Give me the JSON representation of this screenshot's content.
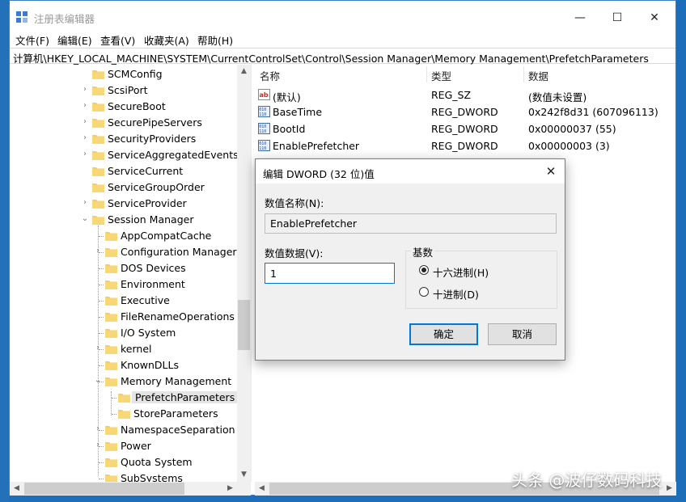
{
  "window": {
    "title": "注册表编辑器",
    "controls": {
      "minimize": "—",
      "maximize": "☐",
      "close": "✕"
    }
  },
  "menu": [
    "文件(F)",
    "编辑(E)",
    "查看(V)",
    "收藏夹(A)",
    "帮助(H)"
  ],
  "address": "计算机\\HKEY_LOCAL_MACHINE\\SYSTEM\\CurrentControlSet\\Control\\Session Manager\\Memory Management\\PrefetchParameters",
  "tree": [
    {
      "label": "SCMConfig",
      "expander": ""
    },
    {
      "label": "ScsiPort",
      "expander": "›"
    },
    {
      "label": "SecureBoot",
      "expander": "›"
    },
    {
      "label": "SecurePipeServers",
      "expander": "›"
    },
    {
      "label": "SecurityProviders",
      "expander": "›"
    },
    {
      "label": "ServiceAggregatedEvents",
      "expander": "›"
    },
    {
      "label": "ServiceCurrent",
      "expander": ""
    },
    {
      "label": "ServiceGroupOrder",
      "expander": ""
    },
    {
      "label": "ServiceProvider",
      "expander": "›"
    },
    {
      "label": "Session Manager",
      "expander": "⌄"
    },
    {
      "label": "AppCompatCache",
      "expander": ""
    },
    {
      "label": "Configuration Manager",
      "expander": "›"
    },
    {
      "label": "DOS Devices",
      "expander": ""
    },
    {
      "label": "Environment",
      "expander": ""
    },
    {
      "label": "Executive",
      "expander": ""
    },
    {
      "label": "FileRenameOperations",
      "expander": ""
    },
    {
      "label": "I/O System",
      "expander": ""
    },
    {
      "label": "kernel",
      "expander": "›"
    },
    {
      "label": "KnownDLLs",
      "expander": ""
    },
    {
      "label": "Memory Management",
      "expander": "⌄"
    },
    {
      "label": "PrefetchParameters",
      "expander": ""
    },
    {
      "label": "StoreParameters",
      "expander": ""
    },
    {
      "label": "NamespaceSeparation",
      "expander": "›"
    },
    {
      "label": "Power",
      "expander": "›"
    },
    {
      "label": "Quota System",
      "expander": ""
    },
    {
      "label": "SubSystems",
      "expander": ""
    }
  ],
  "list": {
    "headers": {
      "name": "名称",
      "type": "类型",
      "data": "数据"
    },
    "rows": [
      {
        "icon": "string-value-icon",
        "name": "(默认)",
        "type": "REG_SZ",
        "data": "(数值未设置)"
      },
      {
        "icon": "binary-value-icon",
        "name": "BaseTime",
        "type": "REG_DWORD",
        "data": "0x242f8d31 (607096113)"
      },
      {
        "icon": "binary-value-icon",
        "name": "BootId",
        "type": "REG_DWORD",
        "data": "0x00000037 (55)"
      },
      {
        "icon": "binary-value-icon",
        "name": "EnablePrefetcher",
        "type": "REG_DWORD",
        "data": "0x00000003 (3)"
      }
    ]
  },
  "dialog": {
    "title": "编辑 DWORD (32 位)值",
    "name_label": "数值名称(N):",
    "name_value": "EnablePrefetcher",
    "data_label": "数值数据(V):",
    "data_value": "1",
    "base_label": "基数",
    "radio_hex": "十六进制(H)",
    "radio_dec": "十进制(D)",
    "selected_base": "hex",
    "ok": "确定",
    "cancel": "取消"
  },
  "watermark": "头条 @波仔数码科技",
  "colors": {
    "accent": "#0078d7",
    "folder": "#f4cd6b",
    "desktop": "#1c6fb8"
  }
}
